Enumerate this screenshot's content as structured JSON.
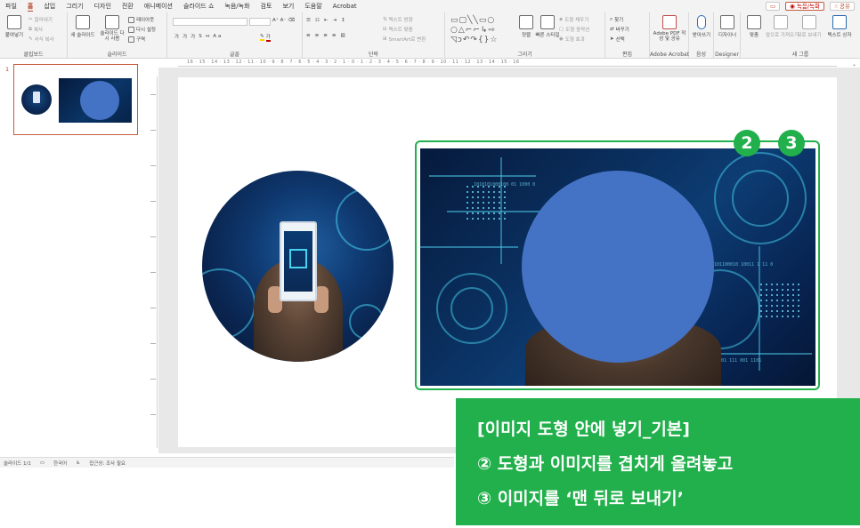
{
  "menu": {
    "tabs": [
      "파일",
      "홈",
      "삽입",
      "그리기",
      "디자인",
      "전환",
      "애니메이션",
      "슬라이드 쇼",
      "녹음/녹화",
      "검토",
      "보기",
      "도움말",
      "Acrobat"
    ],
    "active_tab": "홈",
    "record_button": "◉ 녹음/녹화",
    "share_button": "☝ 공유"
  },
  "ribbon": {
    "clipboard": {
      "label": "클립보드",
      "paste": "붙여넣기",
      "cut": "잘라내기",
      "copy": "복사",
      "format_painter": "서식 복사"
    },
    "slides": {
      "label": "슬라이드",
      "new_slide": "새 슬라이드",
      "reuse": "슬라이드 다시 사용",
      "layout": "레이아웃",
      "reset": "다시 설정",
      "section": "구역"
    },
    "font": {
      "label": "글꼴"
    },
    "paragraph": {
      "label": "단락",
      "text_direction": "텍스트 방향",
      "align_text": "텍스트 맞춤",
      "smartart": "SmartArt로 변환"
    },
    "drawing": {
      "label": "그리기",
      "arrange": "정렬",
      "quick_styles": "빠른 스타일",
      "shape_fill": "도형 채우기",
      "shape_outline": "도형 윤곽선",
      "shape_effects": "도형 효과"
    },
    "editing": {
      "label": "편집",
      "find": "찾기",
      "replace": "바꾸기",
      "select": "선택"
    },
    "acrobat": {
      "label": "Adobe Acrobat",
      "create_pdf": "Adobe PDF 작성 및 공유"
    },
    "voice": {
      "label": "음성",
      "dictate": "받아쓰기"
    },
    "designer": {
      "label": "Designer",
      "design_ideas": "디자이너"
    },
    "new_group": {
      "label": "새 그룹",
      "sort": "맞춤",
      "bring_forward": "앞으로 가져오기",
      "send_backward": "뒤로 보내기",
      "text_box": "텍스트 상자"
    }
  },
  "ruler": {
    "top_ticks": "16 · 15 · 14 · 13 · 12 · 11 · 10 · 9 · 8 · 7 · 6 · 5 · 4 · 3 · 2 · 1 · 0 · 1 · 2 · 3 · 4 · 5 · 6 · 7 · 8 · 9 · 10 · 11 · 12 · 13 · 14 · 15 · 16"
  },
  "thumbnail": {
    "slide_number": "1"
  },
  "slide": {
    "rect_binary_1": "1010101000100 01 1000 0",
    "rect_binary_2": "01011001 111 001 1101",
    "rect_binary_3": "101100010 10011 1 11 0",
    "badge_2": "2",
    "badge_3": "3"
  },
  "caption": {
    "line1": "[이미지 도형 안에 넣기_기본]",
    "line2": "② 도형과 이미지를 겹치게 올려놓고",
    "line3": "③ 이미지를 ‘맨 뒤로 보내기’"
  },
  "status": {
    "slide_count": "슬라이드 1/1",
    "language": "한국어",
    "accessibility": "접근성: 조사 필요"
  },
  "colors": {
    "accent_green": "#21b04b",
    "placeholder_blue": "#4472c4",
    "office_red": "#b7472a"
  }
}
